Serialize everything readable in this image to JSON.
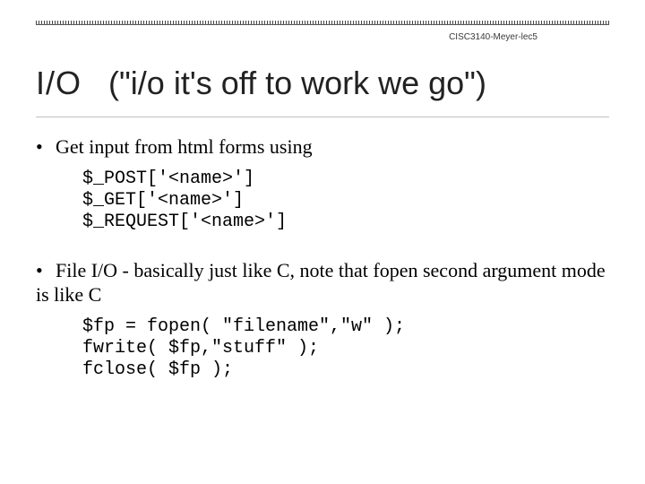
{
  "meta": {
    "header": "CISC3140-Meyer-lec5"
  },
  "title": {
    "io": "I/O",
    "tag": "(\"i/o it's off to work we go\")"
  },
  "bullets": {
    "b1": "Get input from html forms using",
    "b2": "File I/O -  basically just like C, note that fopen second argument mode is like C"
  },
  "code": {
    "c1": "$_POST['<name>']\n$_GET['<name>']\n$_REQUEST['<name>']",
    "c2": "$fp = fopen( \"filename\",\"w\" );\nfwrite( $fp,\"stuff\" );\nfclose( $fp );"
  }
}
